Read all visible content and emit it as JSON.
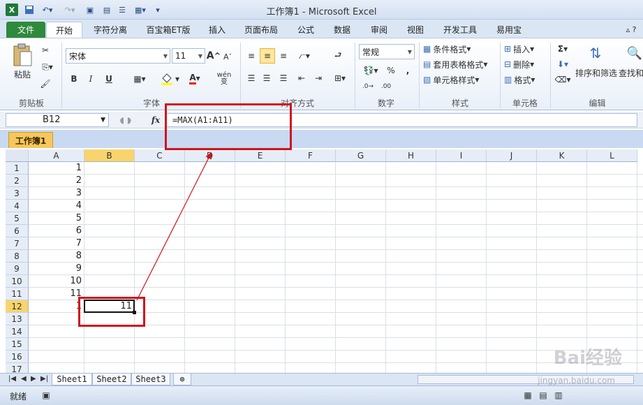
{
  "window": {
    "title": "工作簿1 - Microsoft Excel"
  },
  "tabs": [
    "文件",
    "开始",
    "字符分离",
    "百宝箱ET版",
    "插入",
    "页面布局",
    "公式",
    "数据",
    "审阅",
    "视图",
    "开发工具",
    "易用宝"
  ],
  "ribbon": {
    "clipboard": {
      "paste_label": "粘贴",
      "group_label": "剪贴板"
    },
    "font": {
      "font_name": "宋体",
      "font_size": "11",
      "group_label": "字体",
      "bold": "B",
      "italic": "I",
      "underline": "U",
      "font_color_letter": "A",
      "grow": "A",
      "shrink": "A",
      "wen": "wén\n变"
    },
    "alignment": {
      "group_label": "对齐方式"
    },
    "number": {
      "format": "常规",
      "percent": "%",
      "comma": ",",
      "group_label": "数字"
    },
    "styles": {
      "conditional": "条件格式",
      "table_format": "套用表格格式",
      "cell_styles": "单元格样式",
      "group_label": "样式"
    },
    "cells": {
      "insert": "插入",
      "delete": "删除",
      "format": "格式",
      "group_label": "单元格"
    },
    "editing": {
      "sigma": "Σ",
      "sort_filter": "排序和筛选",
      "find_select": "查找和",
      "group_label": "编辑"
    }
  },
  "formula_bar": {
    "name_box": "B12",
    "fx": "fx",
    "formula": "=MAX(A1:A11)"
  },
  "workbook_tab": "工作簿1",
  "columns": [
    "A",
    "B",
    "C",
    "D",
    "E",
    "F",
    "G",
    "H",
    "I",
    "J",
    "K",
    "L"
  ],
  "rows": [
    "1",
    "2",
    "3",
    "4",
    "5",
    "6",
    "7",
    "8",
    "9",
    "10",
    "11",
    "12",
    "13",
    "14",
    "15",
    "16",
    "17"
  ],
  "column_a_values": [
    "1",
    "2",
    "3",
    "4",
    "5",
    "6",
    "7",
    "8",
    "9",
    "10",
    "11",
    "1"
  ],
  "b12_value": "11",
  "sheets": [
    "Sheet1",
    "Sheet2",
    "Sheet3"
  ],
  "status": {
    "text": "就绪"
  },
  "watermark": {
    "brand": "Bai经验",
    "url": "jingyan.baidu.com"
  },
  "colors": {
    "annotation": "#d0141c",
    "selected_header": "#f7d56c",
    "file_tab": "#2f8a3b"
  }
}
